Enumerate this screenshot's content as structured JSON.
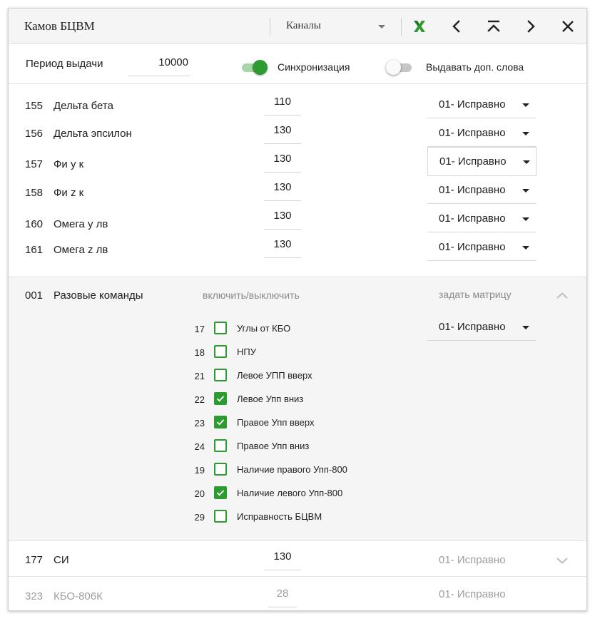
{
  "header": {
    "title": "Камов БЦВМ",
    "channel_select": "Каналы"
  },
  "params": {
    "period_label": "Период выдачи",
    "period_value": "10000",
    "sync_label": "Синхронизация",
    "sync_on": true,
    "extra_label": "Выдавать доп. слова",
    "extra_on": false
  },
  "rows": [
    {
      "num": "155",
      "name": "Дельта бета",
      "value": "110",
      "status": "01- Исправно"
    },
    {
      "num": "156",
      "name": "Дельта эпсилон",
      "value": "130",
      "status": "01- Исправно"
    },
    {
      "num": "157",
      "name": "Фи у к",
      "value": "130",
      "status": "01- Исправно"
    },
    {
      "num": "158",
      "name": "Фи z к",
      "value": "130",
      "status": "01- Исправно"
    },
    {
      "num": "160",
      "name": "Омега у лв",
      "value": "130",
      "status": "01- Исправно"
    },
    {
      "num": "161",
      "name": "Омега z лв",
      "value": "130",
      "status": "01- Исправно"
    }
  ],
  "section": {
    "num": "001",
    "name": "Разовые команды",
    "toggle_all": "включить/выключить",
    "matrix": "задать матрицу",
    "status": "01- Исправно",
    "commands": [
      {
        "num": "17",
        "label": "Углы от КБО",
        "checked": false
      },
      {
        "num": "18",
        "label": "НПУ",
        "checked": false
      },
      {
        "num": "21",
        "label": "Левое УПП вверх",
        "checked": false
      },
      {
        "num": "22",
        "label": "Левое Упп вниз",
        "checked": true
      },
      {
        "num": "23",
        "label": "Правое Упп вверх",
        "checked": true
      },
      {
        "num": "24",
        "label": "Правое Упп вниз",
        "checked": false
      },
      {
        "num": "19",
        "label": "Наличие правого Упп-800",
        "checked": false
      },
      {
        "num": "20",
        "label": "Наличие левого Упп-800",
        "checked": true
      },
      {
        "num": "29",
        "label": "Исправность БЦВМ",
        "checked": false
      }
    ]
  },
  "bottom_rows": [
    {
      "num": "177",
      "name": "СИ",
      "value": "130",
      "status": "01- Исправно"
    },
    {
      "num": "323",
      "name": "КБО-806К",
      "value": "28",
      "status": "01- Исправно"
    }
  ],
  "colors": {
    "accent": "#2e9b32",
    "excel_icon": "#2e9b32",
    "muted_text": "#8a8a8a"
  }
}
